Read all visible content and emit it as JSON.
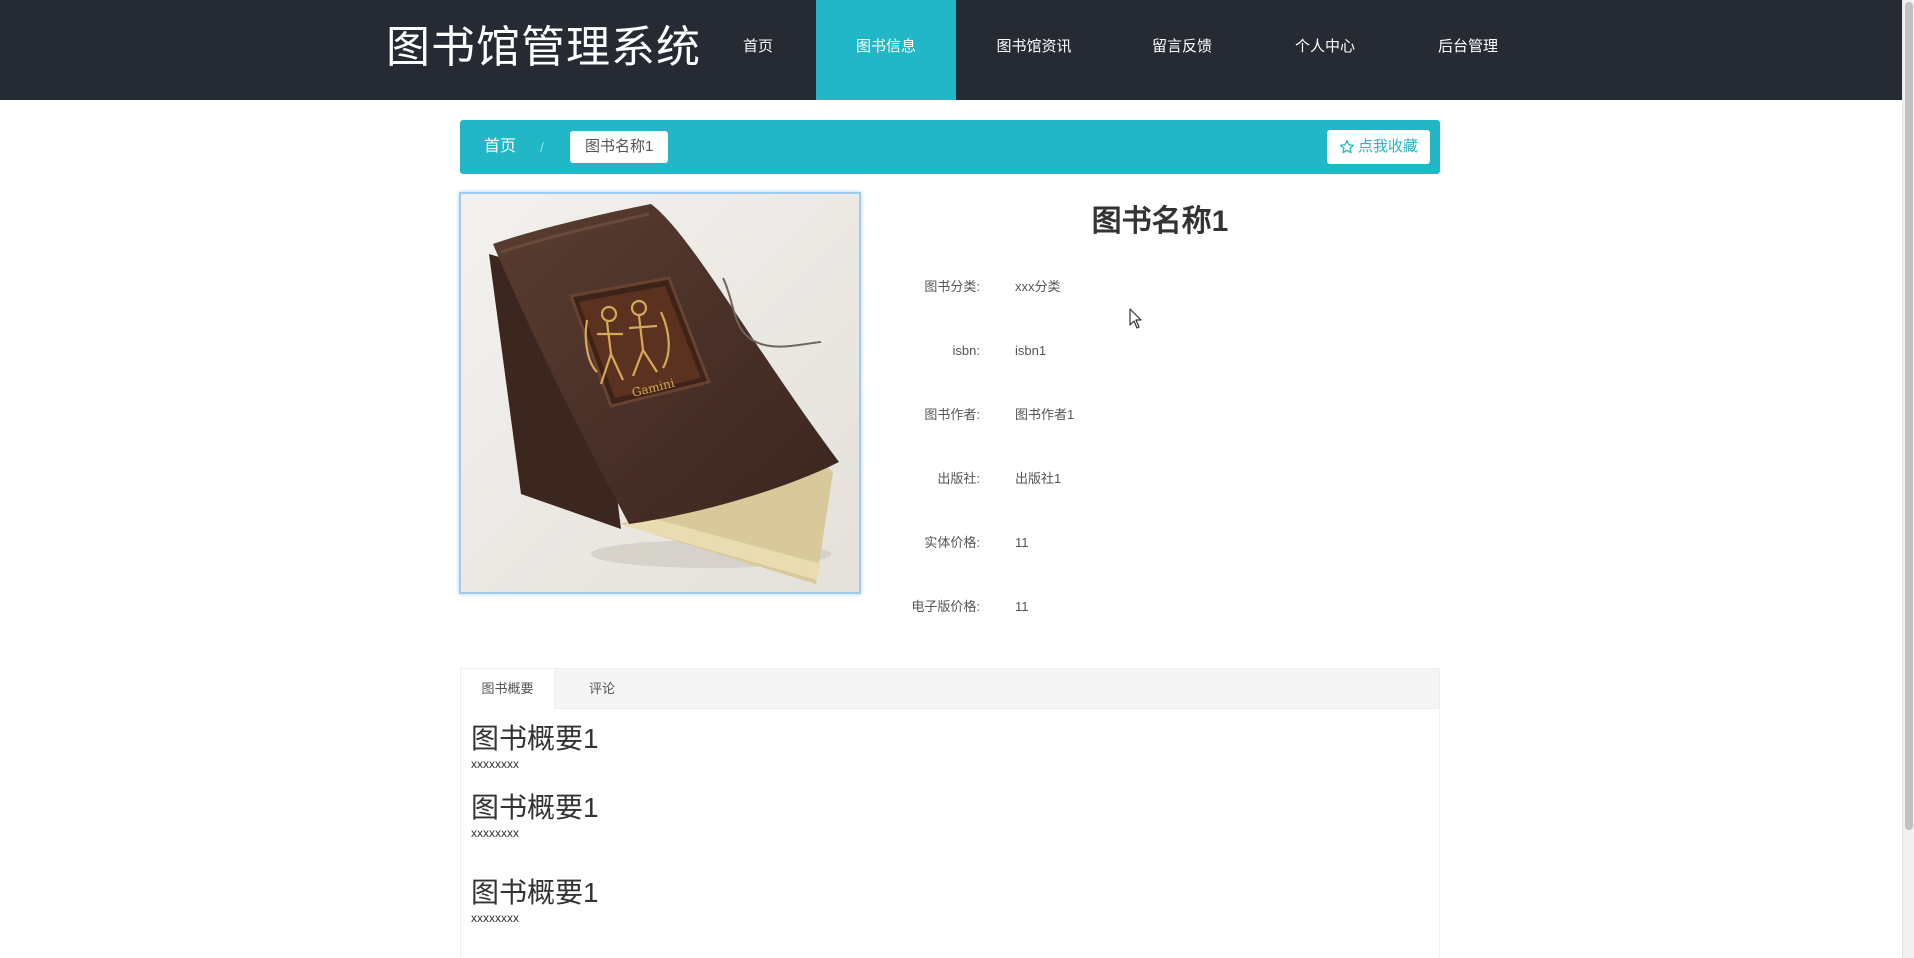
{
  "header": {
    "brand": "图书馆管理系统",
    "nav": [
      {
        "label": "首页"
      },
      {
        "label": "图书信息"
      },
      {
        "label": "图书馆资讯"
      },
      {
        "label": "留言反馈"
      },
      {
        "label": "个人中心"
      },
      {
        "label": "后台管理"
      }
    ],
    "active_nav": "图书信息"
  },
  "breadcrumb": {
    "home": "首页",
    "separator": "/",
    "current": "图书名称1"
  },
  "favorite_button": {
    "icon": "star-outline-icon",
    "label": "点我收藏"
  },
  "book": {
    "image_alt": "book-cover-photo",
    "title": "图书名称1",
    "details": [
      {
        "label": "图书分类:",
        "value": "xxx分类"
      },
      {
        "label": "isbn:",
        "value": "isbn1"
      },
      {
        "label": "图书作者:",
        "value": "图书作者1"
      },
      {
        "label": "出版社:",
        "value": "出版社1"
      },
      {
        "label": "实体价格:",
        "value": "11"
      },
      {
        "label": "电子版价格:",
        "value": "11"
      }
    ]
  },
  "tabs": {
    "items": [
      {
        "label": "图书概要"
      },
      {
        "label": "评论"
      }
    ],
    "active": "图书概要"
  },
  "summary": [
    {
      "heading": "图书概要1",
      "text": "xxxxxxxx"
    },
    {
      "heading": "图书概要1",
      "text": "xxxxxxxx"
    },
    {
      "heading": "图书概要1",
      "text": "xxxxxxxx"
    }
  ],
  "colors": {
    "header_bg": "#262a33",
    "accent": "#22b7c6"
  }
}
